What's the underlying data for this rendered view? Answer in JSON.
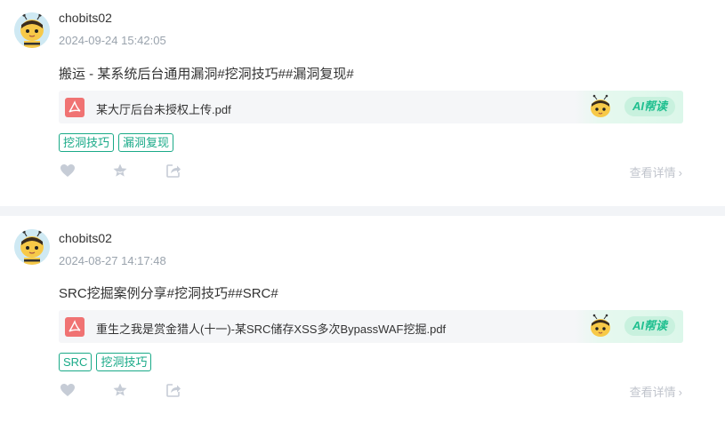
{
  "posts": [
    {
      "author": "chobits02",
      "time": "2024-09-24 15:42:05",
      "content": "搬运  - 某系统后台通用漏洞#挖洞技巧##漏洞复现#",
      "attachment": "某大厅后台未授权上传.pdf",
      "ai_label": "AI帮读",
      "tags": [
        "挖洞技巧",
        "漏洞复现"
      ],
      "detail_label": "查看详情"
    },
    {
      "author": "chobits02",
      "time": "2024-08-27 14:17:48",
      "content": "SRC挖掘案例分享#挖洞技巧##SRC#",
      "attachment": "重生之我是赏金猎人(十一)-某SRC储存XSS多次BypassWAF挖掘.pdf",
      "ai_label": "AI帮读",
      "tags": [
        "SRC",
        "挖洞技巧"
      ],
      "detail_label": "查看详情"
    }
  ],
  "icons": {
    "like": "heart-icon",
    "favorite": "star-icon",
    "share": "share-icon",
    "pdf": "pdf-icon",
    "ai": "bee-mascot-icon",
    "detail": "chevron-right-icon"
  },
  "colors": {
    "accent": "#1aaa88",
    "pdf": "#f07373",
    "ai_bg": "#c8f1de",
    "divider": "#f2f4f7"
  }
}
